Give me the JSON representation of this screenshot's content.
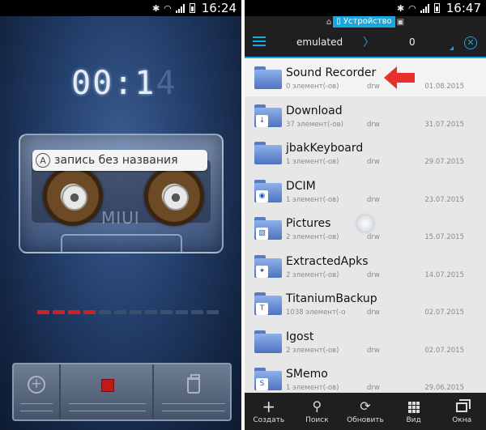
{
  "left": {
    "status": {
      "time": "16:24"
    },
    "timer": {
      "main": "00:",
      "bright": "1",
      "dim": "4"
    },
    "recording_name": "запись без названия",
    "cassette_brand": "MIUI",
    "level_meter": {
      "total_segments": 12,
      "active_segments": 4
    }
  },
  "right": {
    "status": {
      "time": "16:47"
    },
    "toolbar": {
      "device_tab": "Устройство",
      "path": "emulated",
      "count": "0"
    },
    "files": [
      {
        "name": "Sound Recorder",
        "meta": "0 элемент(-ов)",
        "perm": "drw",
        "date": "01.08.2015",
        "badge": ""
      },
      {
        "name": "Download",
        "meta": "37 элемент(-ов)",
        "perm": "drw",
        "date": "31.07.2015",
        "badge": "↓"
      },
      {
        "name": "jbakKeyboard",
        "meta": "1 элемент(-ов)",
        "perm": "drw",
        "date": "29.07.2015",
        "badge": ""
      },
      {
        "name": "DCIM",
        "meta": "1 элемент(-ов)",
        "perm": "drw",
        "date": "23.07.2015",
        "badge": "◉"
      },
      {
        "name": "Pictures",
        "meta": "2 элемент(-ов)",
        "perm": "drw",
        "date": "15.07.2015",
        "badge": "▨"
      },
      {
        "name": "ExtractedApks",
        "meta": "2 элемент(-ов)",
        "perm": "drw",
        "date": "14.07.2015",
        "badge": "✦"
      },
      {
        "name": "TitaniumBackup",
        "meta": "1038 элемент(-о",
        "perm": "drw",
        "date": "02.07.2015",
        "badge": "T"
      },
      {
        "name": "Igost",
        "meta": "2 элемент(-ов)",
        "perm": "drw",
        "date": "02.07.2015",
        "badge": ""
      },
      {
        "name": "SMemo",
        "meta": "1 элемент(-ов)",
        "perm": "drw",
        "date": "29.06.2015",
        "badge": "S"
      }
    ],
    "bottom_bar": [
      {
        "label": "Создать",
        "icon": "plus-icon"
      },
      {
        "label": "Поиск",
        "icon": "search-icon"
      },
      {
        "label": "Обновить",
        "icon": "refresh-icon"
      },
      {
        "label": "Вид",
        "icon": "grid-icon"
      },
      {
        "label": "Окна",
        "icon": "windows-icon"
      }
    ]
  },
  "colors": {
    "accent": "#19a7e0",
    "record_red": "#d11f2a",
    "arrow_red": "#e8302a"
  }
}
